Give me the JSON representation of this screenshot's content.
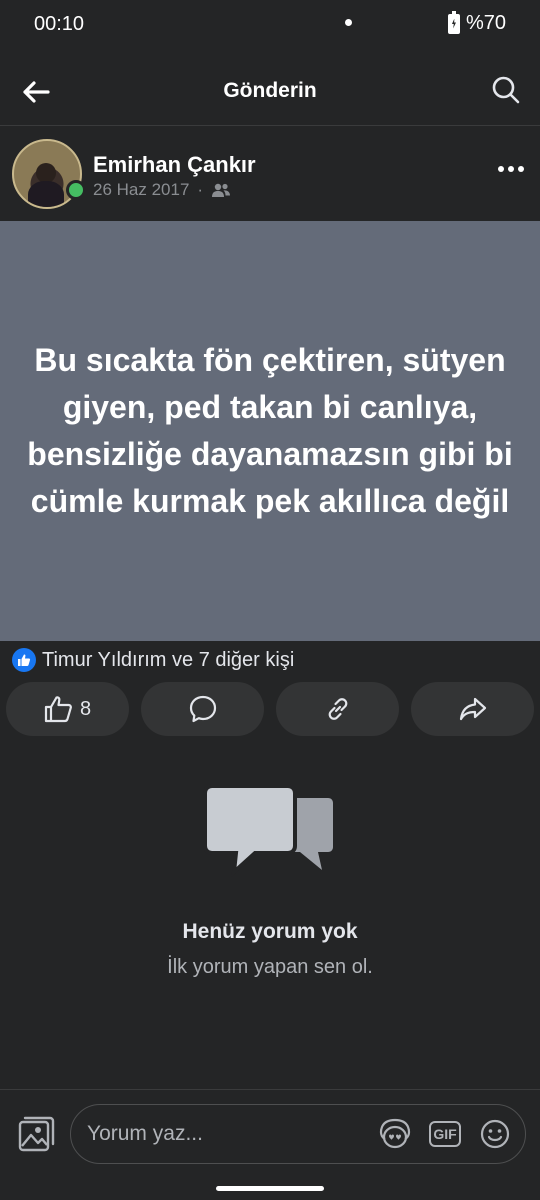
{
  "status_bar": {
    "time": "00:10",
    "battery": "%70"
  },
  "header": {
    "title": "Gönderin"
  },
  "post": {
    "author": "Emirhan Çankır",
    "date": "26 Haz 2017",
    "dot": "·",
    "text": "Bu sıcakta fön çektiren, sütyen giyen, ped takan bi canlıya, bensizliğe dayanamazsın gibi bi cümle kurmak pek akıllıca değil"
  },
  "reactions": {
    "summary": "Timur Yıldırım ve 7 diğer kişi",
    "like_count": "8"
  },
  "empty_state": {
    "title": "Henüz yorum yok",
    "subtitle": "İlk yorum yapan sen ol."
  },
  "comment_bar": {
    "placeholder": "Yorum yaz..."
  },
  "colors": {
    "background": "#242526",
    "post_bg": "#646b79",
    "online": "#45bd62",
    "like": "#1877f2"
  }
}
